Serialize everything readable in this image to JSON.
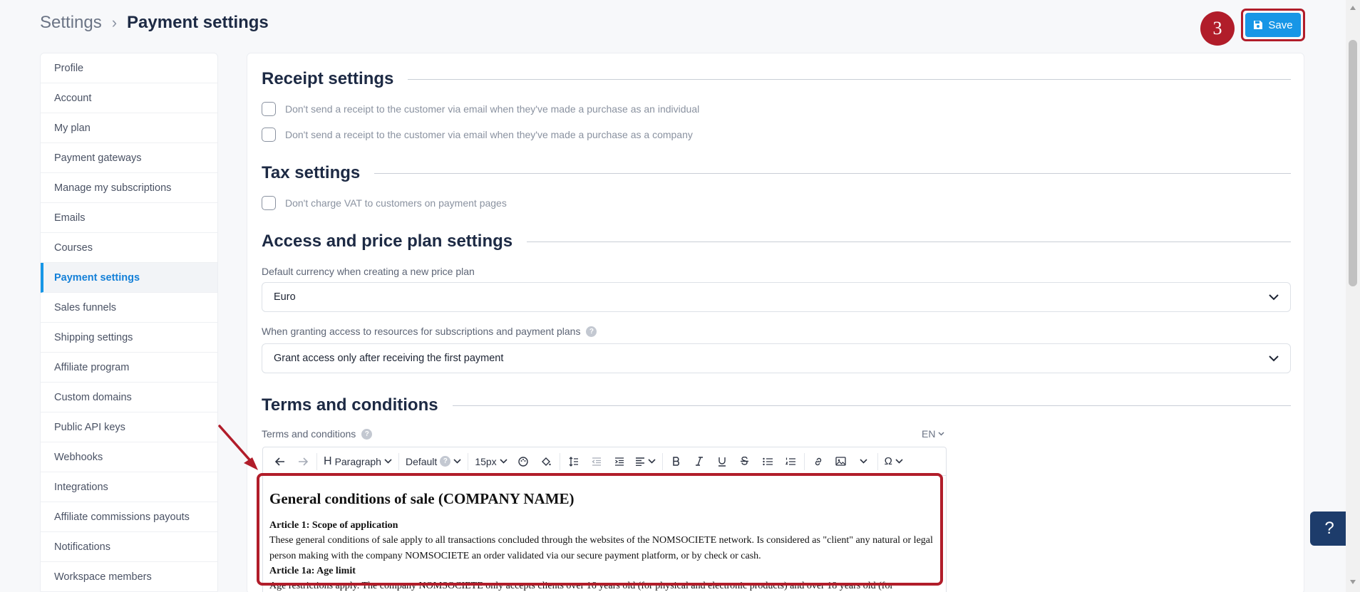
{
  "breadcrumb": {
    "root": "Settings",
    "separator": "›",
    "current": "Payment settings"
  },
  "step_badge": "3",
  "save_label": "Save",
  "sidebar": {
    "items": [
      {
        "label": "Profile",
        "active": false
      },
      {
        "label": "Account",
        "active": false
      },
      {
        "label": "My plan",
        "active": false
      },
      {
        "label": "Payment gateways",
        "active": false
      },
      {
        "label": "Manage my subscriptions",
        "active": false
      },
      {
        "label": "Emails",
        "active": false
      },
      {
        "label": "Courses",
        "active": false
      },
      {
        "label": "Payment settings",
        "active": true
      },
      {
        "label": "Sales funnels",
        "active": false
      },
      {
        "label": "Shipping settings",
        "active": false
      },
      {
        "label": "Affiliate program",
        "active": false
      },
      {
        "label": "Custom domains",
        "active": false
      },
      {
        "label": "Public API keys",
        "active": false
      },
      {
        "label": "Webhooks",
        "active": false
      },
      {
        "label": "Integrations",
        "active": false
      },
      {
        "label": "Affiliate commissions payouts",
        "active": false
      },
      {
        "label": "Notifications",
        "active": false
      },
      {
        "label": "Workspace members",
        "active": false
      }
    ]
  },
  "receipt": {
    "title": "Receipt settings",
    "options": [
      "Don't send a receipt to the customer via email when they've made a purchase as an individual",
      "Don't send a receipt to the customer via email when they've made a purchase as a company"
    ]
  },
  "tax": {
    "title": "Tax settings",
    "option": "Don't charge VAT to customers on payment pages"
  },
  "access": {
    "title": "Access and price plan settings",
    "currency_label": "Default currency when creating a new price plan",
    "currency_value": "Euro",
    "grant_label": "When granting access to resources for subscriptions and payment plans",
    "grant_value": "Grant access only after receiving the first payment"
  },
  "terms": {
    "title": "Terms and conditions",
    "label": "Terms and conditions",
    "language": "EN",
    "toolbar": {
      "block": "Paragraph",
      "font": "Default",
      "size": "15px"
    },
    "content": {
      "heading": "General conditions of sale (COMPANY NAME)",
      "article1_title": "Article 1: Scope of application",
      "article1_text": "These general conditions of sale apply to all transactions concluded through the websites of the NOMSOCIETE network. Is considered as \"client\" any natural or legal person making with the company NOMSOCIETE an order validated via our secure payment platform, or by check or cash.",
      "article1a_title": "Article 1a: Age limit",
      "article1a_text": "Age restrictions apply. The company NOMSOCIETE only accepts clients over 16 years old (for physical and electronic products) and over 18 years old (for"
    }
  },
  "help_label": "?",
  "colors": {
    "accent": "#1796e6",
    "annotation": "#b11d2a",
    "heading": "#1d2a44"
  }
}
